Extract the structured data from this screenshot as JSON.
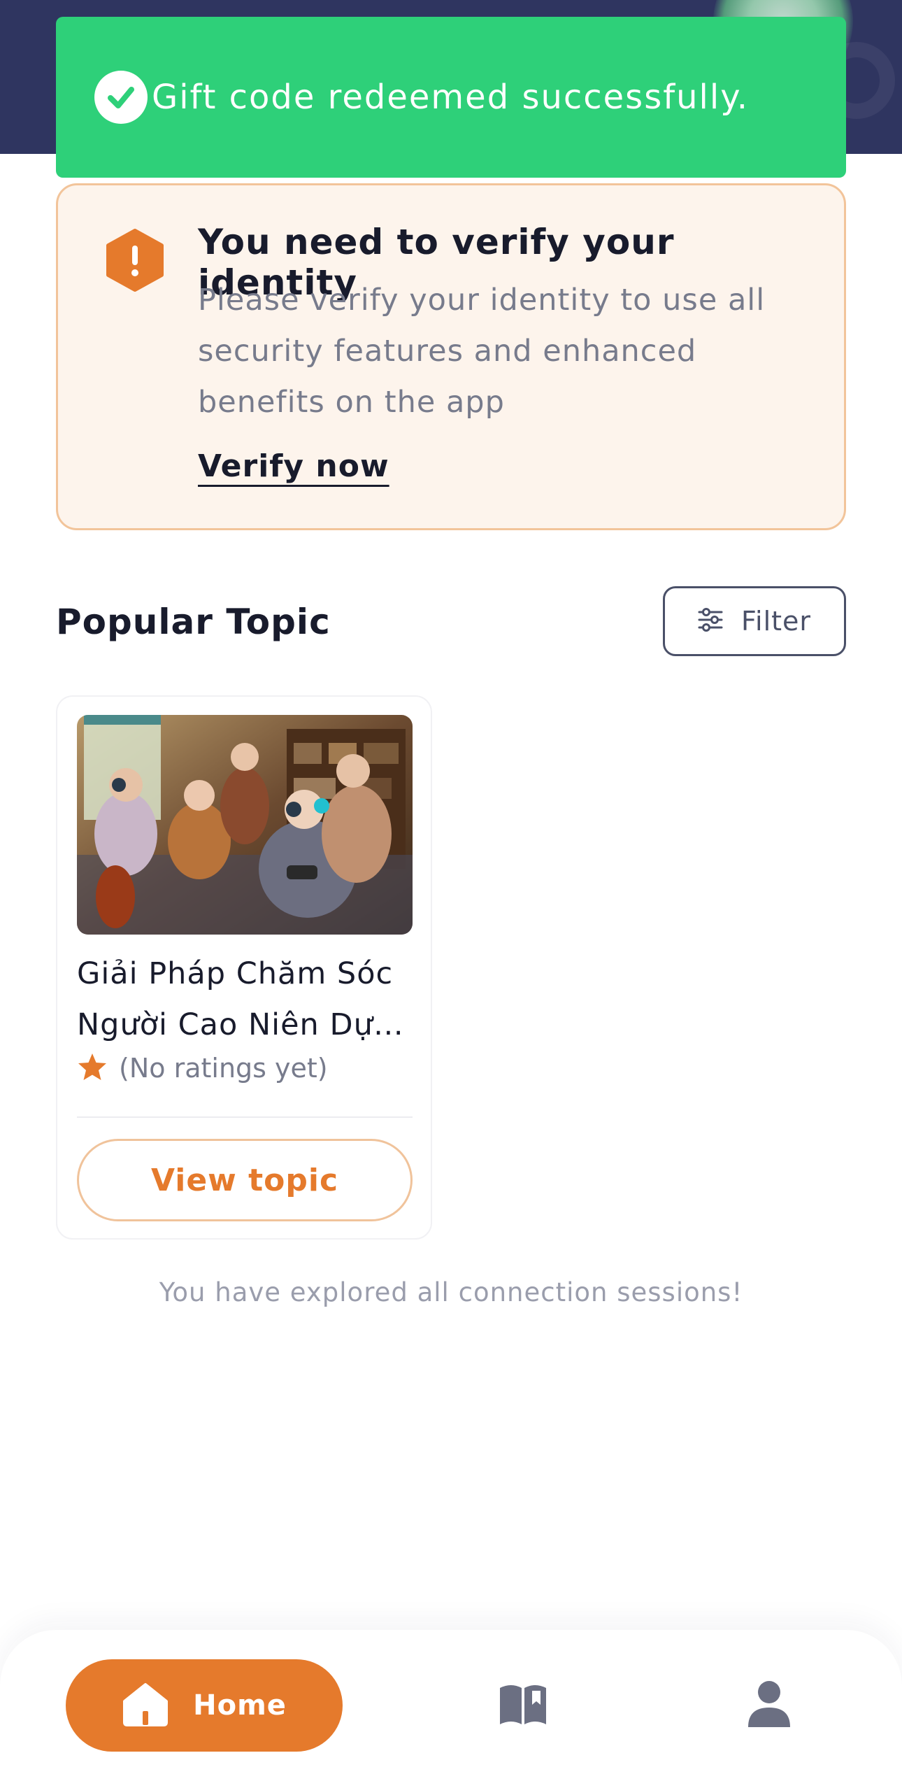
{
  "toast": {
    "message": "Gift code redeemed successfully.",
    "icon": "check-circle-icon",
    "color": "#2ed079"
  },
  "verify_banner": {
    "title": "You need to verify your identity",
    "description": "Please verify your identity to use all security features and enhanced benefits on the app",
    "action_label": "Verify now",
    "icon": "warning-hexagon-icon",
    "accent": "#e57a2c"
  },
  "section": {
    "title": "Popular Topic",
    "filter_label": "Filter",
    "filter_icon": "sliders-icon"
  },
  "topics": [
    {
      "title": "Giải Pháp Chăm Sóc Người Cao Niên Dự…",
      "rating_text": "(No ratings yet)",
      "button_label": "View topic"
    }
  ],
  "footer_message": "You have explored all connection sessions!",
  "nav": {
    "home_label": "Home",
    "items": [
      "home-icon",
      "library-icon",
      "profile-icon"
    ],
    "active_color": "#e57a2c"
  }
}
